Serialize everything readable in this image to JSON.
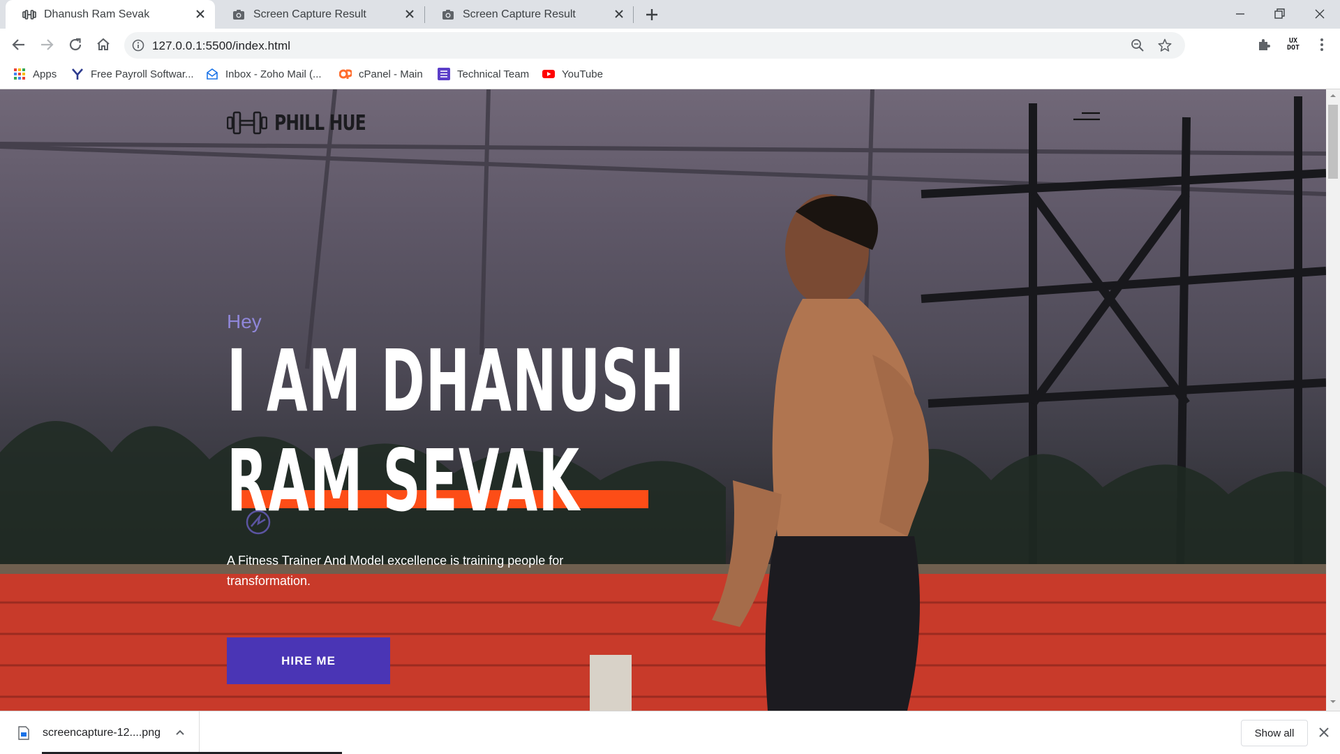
{
  "browser": {
    "tabs": [
      {
        "title": "Dhanush Ram Sevak",
        "icon": "dumbbell-icon",
        "active": true
      },
      {
        "title": "Screen Capture Result",
        "icon": "camera-icon",
        "active": false
      },
      {
        "title": "Screen Capture Result",
        "icon": "camera-icon",
        "active": false
      }
    ],
    "url": "127.0.0.1:5500/index.html",
    "bookmarks": [
      {
        "label": "Apps",
        "icon": "apps-grid-icon"
      },
      {
        "label": "Free Payroll Softwar...",
        "icon": "yahoo-y-icon"
      },
      {
        "label": "Inbox - Zoho Mail (...",
        "icon": "zoho-mail-icon"
      },
      {
        "label": "cPanel - Main",
        "icon": "cpanel-icon"
      },
      {
        "label": "Technical Team",
        "icon": "list-icon"
      },
      {
        "label": "YouTube",
        "icon": "youtube-icon"
      }
    ],
    "extension_badge": "UX DOT"
  },
  "page": {
    "logo_text": "PHILL HUE",
    "greeting": "Hey",
    "headline_line1": "I AM DHANUSH",
    "headline_line2": "RAM SEVAK",
    "tagline": "A Fitness Trainer And Model excellence is training people for transformation.",
    "cta_label": "HIRE ME"
  },
  "downloads": {
    "file_name": "screencapture-12....png",
    "show_all_label": "Show all"
  },
  "colors": {
    "accent_purple": "#4a35b5",
    "greeting_purple": "#8f86d8",
    "accent_orange": "#fd4d17",
    "headline_white": "#ffffff"
  }
}
